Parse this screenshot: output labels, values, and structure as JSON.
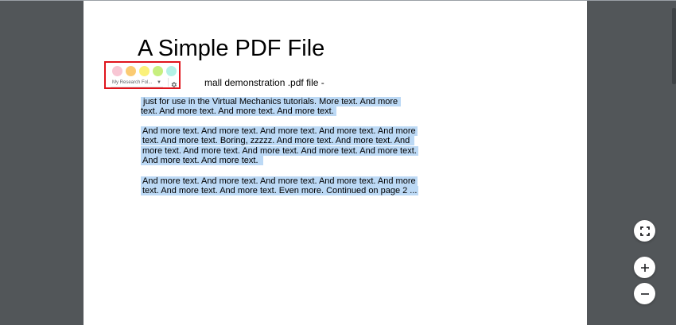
{
  "document": {
    "title": "A Simple PDF File",
    "intro_text": "mall demonstration .pdf file -",
    "paragraphs": [
      {
        "lines": [
          "just for use in the Virtual Mechanics tutorials. More text. And more",
          "text. And more text. And more text. And more text."
        ]
      },
      {
        "lines": [
          "And more text. And more text. And more text. And more text. And more",
          "text. And more text. Boring, zzzzz. And more text. And more text. And",
          "more text. And more text. And more text. And more text. And more text.",
          "And more text. And more text."
        ]
      },
      {
        "lines": [
          "And more text. And more text. And more text. And more text. And more",
          "text. And more text. And more text. Even more. Continued on page 2 ..."
        ]
      }
    ]
  },
  "highlight_toolbar": {
    "colors": [
      {
        "name": "pink",
        "hex": "#f8c6d4"
      },
      {
        "name": "orange",
        "hex": "#fbcb73"
      },
      {
        "name": "yellow",
        "hex": "#fbf17a"
      },
      {
        "name": "green",
        "hex": "#c7ef7f"
      },
      {
        "name": "teal",
        "hex": "#b3f1e6"
      }
    ],
    "folder_select": "My Research Fol...",
    "settings_icon": "gear-icon"
  },
  "viewer_controls": {
    "fit_icon": "fullscreen-icon",
    "zoom_in_icon": "plus-icon",
    "zoom_out_icon": "minus-icon"
  },
  "colors": {
    "selection_highlight": "#bcd9f5",
    "toolbar_outline": "#e0141c",
    "viewer_background": "#525659"
  }
}
